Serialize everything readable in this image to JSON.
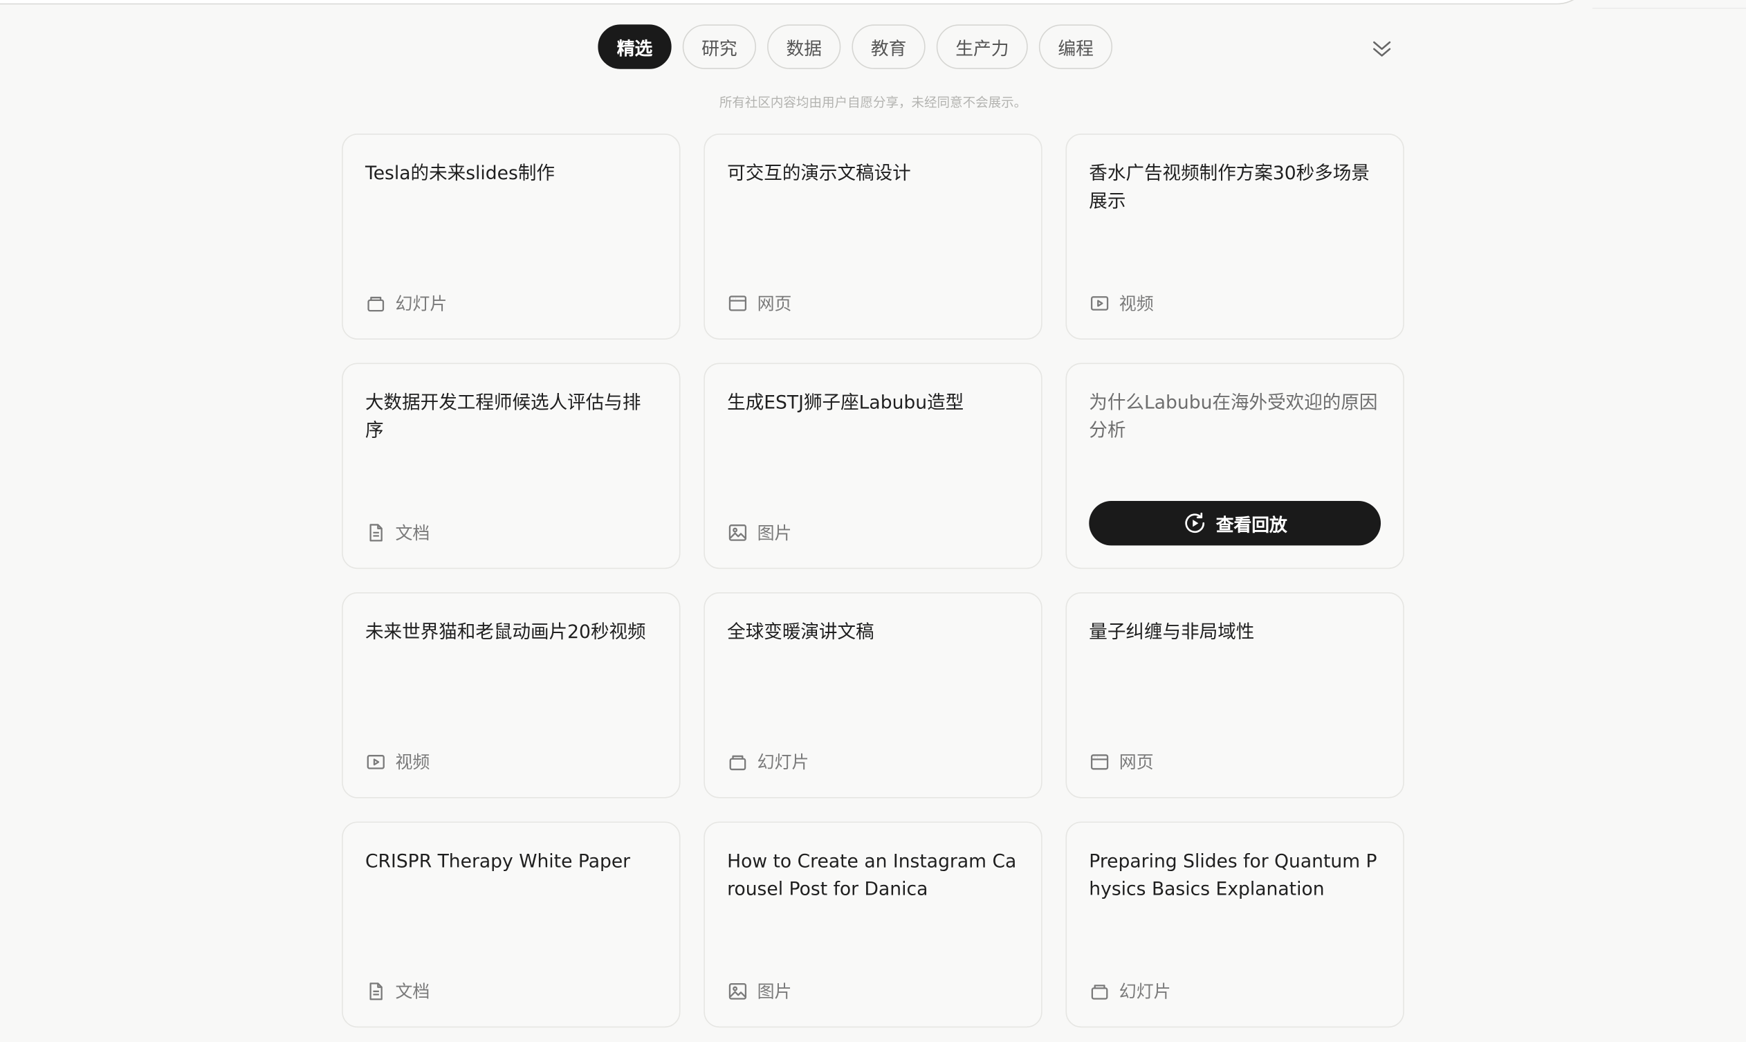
{
  "tabs": [
    {
      "label": "精选",
      "active": true
    },
    {
      "label": "研究",
      "active": false
    },
    {
      "label": "数据",
      "active": false
    },
    {
      "label": "教育",
      "active": false
    },
    {
      "label": "生产力",
      "active": false
    },
    {
      "label": "编程",
      "active": false
    }
  ],
  "expand_icon": "double-chevron-down-icon",
  "notice": "所有社区内容均由用户自愿分享，未经同意不会展示。",
  "cards": [
    {
      "title": "Tesla的未来slides制作",
      "type": "幻灯片",
      "icon": "slides-icon"
    },
    {
      "title": "可交互的演示文稿设计",
      "type": "网页",
      "icon": "webpage-icon"
    },
    {
      "title": "香水广告视频制作方案30秒多场景展示",
      "type": "视频",
      "icon": "video-icon"
    },
    {
      "title": "大数据开发工程师候选人评估与排序",
      "type": "文档",
      "icon": "document-icon"
    },
    {
      "title": "生成ESTJ狮子座Labubu造型",
      "type": "图片",
      "icon": "image-icon"
    },
    {
      "title": "为什么Labubu在海外受欢迎的原因分析",
      "type": "",
      "icon": "",
      "replay_label": "查看回放"
    },
    {
      "title": "未来世界猫和老鼠动画片20秒视频",
      "type": "视频",
      "icon": "video-icon"
    },
    {
      "title": "全球变暖演讲文稿",
      "type": "幻灯片",
      "icon": "slides-icon"
    },
    {
      "title": "量子纠缠与非局域性",
      "type": "网页",
      "icon": "webpage-icon"
    },
    {
      "title": "CRISPR Therapy White Paper",
      "type": "文档",
      "icon": "document-icon"
    },
    {
      "title": "How to Create an Instagram Carousel Post for Danica",
      "type": "图片",
      "icon": "image-icon"
    },
    {
      "title": "Preparing Slides for Quantum Physics Basics Explanation",
      "type": "幻灯片",
      "icon": "slides-icon"
    }
  ],
  "colors": {
    "accent": "#1a1a1a",
    "background": "#f8f8f7",
    "muted": "#7a7a7a"
  }
}
